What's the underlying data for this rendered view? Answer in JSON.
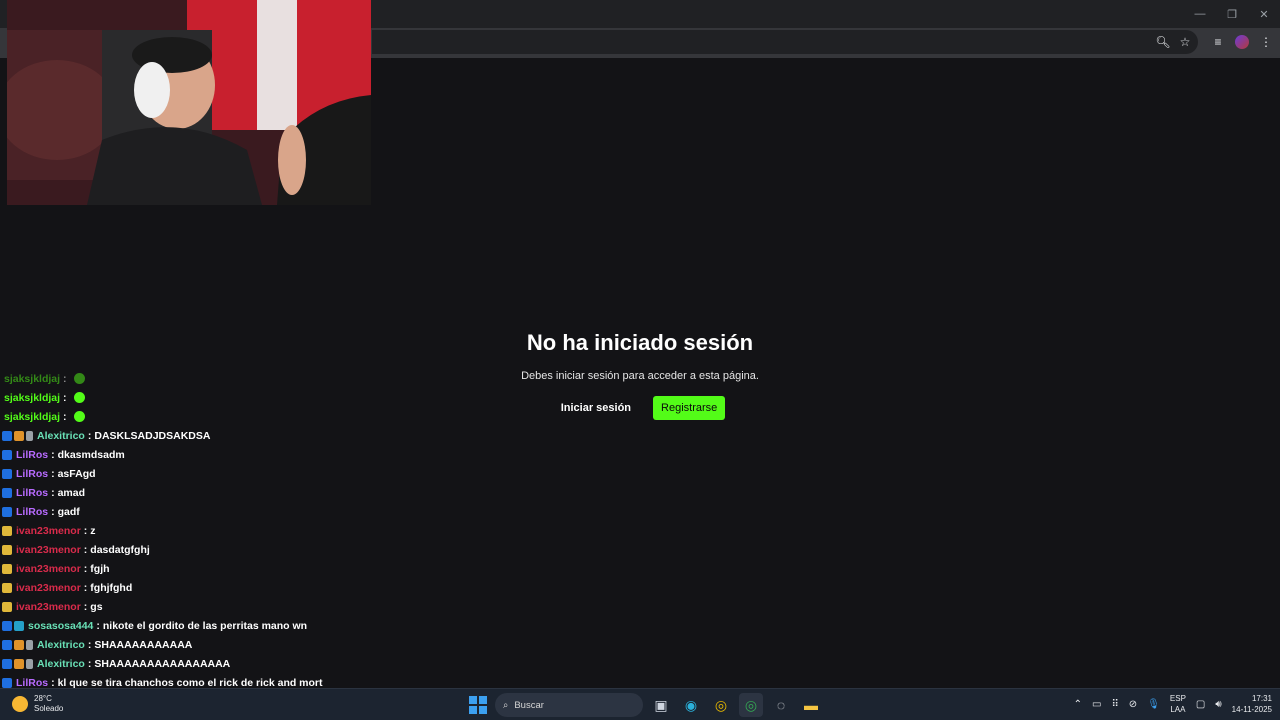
{
  "page": {
    "title": "No ha iniciado sesión",
    "subtitle": "Debes iniciar sesión para acceder a esta página.",
    "login_label": "Iniciar sesión",
    "register_label": "Registrarse",
    "accent": "#53fc18"
  },
  "chat": [
    {
      "user": "sjaksjkldjaj",
      "color": "#53fc18",
      "badges": [],
      "msg": "",
      "emote": true,
      "faded": true
    },
    {
      "user": "sjaksjkldjaj",
      "color": "#53fc18",
      "badges": [],
      "msg": "",
      "emote": true,
      "faded": false
    },
    {
      "user": "sjaksjkldjaj",
      "color": "#53fc18",
      "badges": [],
      "msg": "",
      "emote": true,
      "faded": false
    },
    {
      "user": "Alexitrico",
      "color": "#69e0b6",
      "badges": [
        "a",
        "b",
        "e"
      ],
      "msg": "DASKLSADJDSAKDSA",
      "emote": false,
      "faded": false
    },
    {
      "user": "LilRos",
      "color": "#b86bff",
      "badges": [
        "a"
      ],
      "msg": "dkasmdsadm",
      "emote": false,
      "faded": false
    },
    {
      "user": "LilRos",
      "color": "#b86bff",
      "badges": [
        "a"
      ],
      "msg": "asFAgd",
      "emote": false,
      "faded": false
    },
    {
      "user": "LilRos",
      "color": "#b86bff",
      "badges": [
        "a"
      ],
      "msg": "amad",
      "emote": false,
      "faded": false
    },
    {
      "user": "LilRos",
      "color": "#b86bff",
      "badges": [
        "a"
      ],
      "msg": "gadf",
      "emote": false,
      "faded": false
    },
    {
      "user": "ivan23menor",
      "color": "#d92b4b",
      "badges": [
        "c"
      ],
      "msg": "z",
      "emote": false,
      "faded": false
    },
    {
      "user": "ivan23menor",
      "color": "#d92b4b",
      "badges": [
        "c"
      ],
      "msg": "dasdatgfghj",
      "emote": false,
      "faded": false
    },
    {
      "user": "ivan23menor",
      "color": "#d92b4b",
      "badges": [
        "c"
      ],
      "msg": "fgjh",
      "emote": false,
      "faded": false
    },
    {
      "user": "ivan23menor",
      "color": "#d92b4b",
      "badges": [
        "c"
      ],
      "msg": "fghjfghd",
      "emote": false,
      "faded": false
    },
    {
      "user": "ivan23menor",
      "color": "#d92b4b",
      "badges": [
        "c"
      ],
      "msg": "gs",
      "emote": false,
      "faded": false
    },
    {
      "user": "sosasosa444",
      "color": "#69e0b6",
      "badges": [
        "a",
        "d"
      ],
      "msg": "nikote el gordito de las perritas mano wn",
      "emote": false,
      "faded": false
    },
    {
      "user": "Alexitrico",
      "color": "#69e0b6",
      "badges": [
        "a",
        "b",
        "e"
      ],
      "msg": "SHAAAAAAAAAAA",
      "emote": false,
      "faded": false
    },
    {
      "user": "Alexitrico",
      "color": "#69e0b6",
      "badges": [
        "a",
        "b",
        "e"
      ],
      "msg": "SHAAAAAAAAAAAAAAAA",
      "emote": false,
      "faded": false
    },
    {
      "user": "LilRos",
      "color": "#b86bff",
      "badges": [
        "a"
      ],
      "msg": "kl que se tira chanchos como el rick de rick and mort",
      "emote": false,
      "faded": false
    }
  ],
  "taskbar": {
    "temp": "28°C",
    "weather": "Soleado",
    "search_placeholder": "Buscar",
    "lang_top": "ESP",
    "lang_bottom": "LAA",
    "time": "17:31",
    "date": "14-11-2025"
  }
}
